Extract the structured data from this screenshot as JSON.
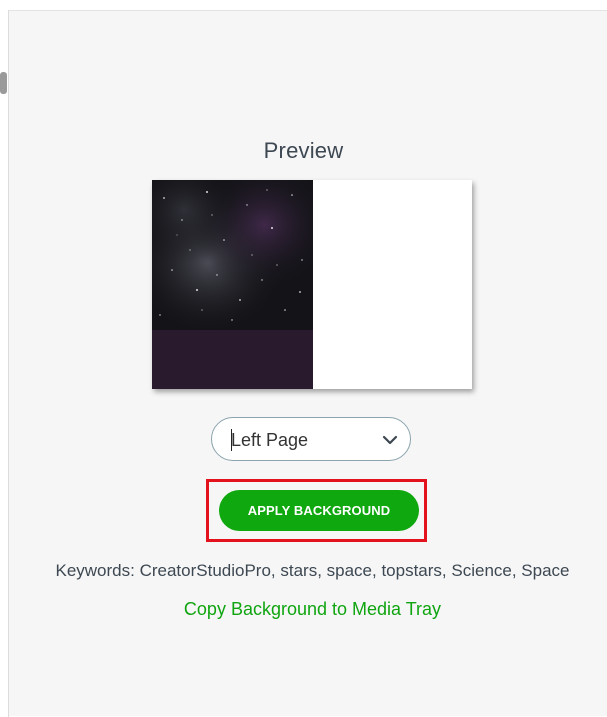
{
  "preview": {
    "title": "Preview"
  },
  "page_select": {
    "selected": "Left Page"
  },
  "actions": {
    "apply_label": "APPLY BACKGROUND",
    "copy_label": "Copy Background to Media Tray"
  },
  "keywords": {
    "text": "Keywords: CreatorStudioPro, stars, space, topstars, Science, Space"
  },
  "colors": {
    "apply_button": "#0fa80f",
    "link": "#10a510",
    "highlight": "#e4121c",
    "panel_bg": "#f6f6f6"
  },
  "icons": {
    "dropdown": "chevron-down-icon"
  }
}
